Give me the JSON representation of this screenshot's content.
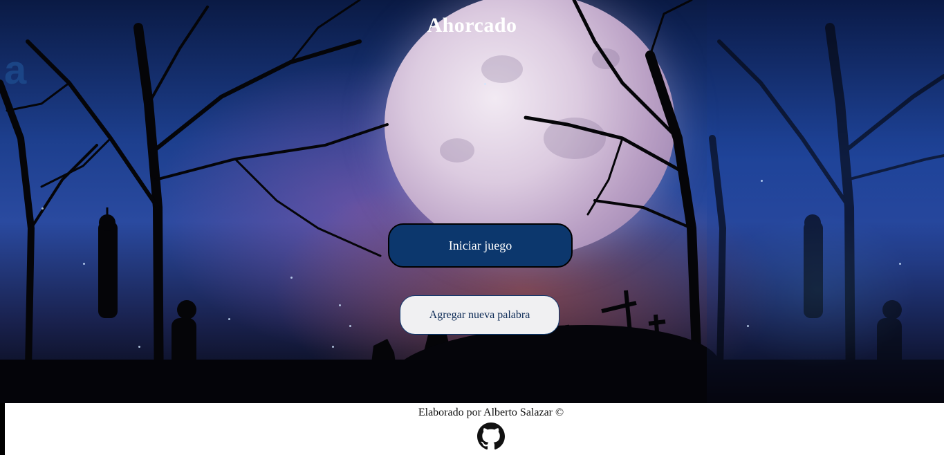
{
  "page": {
    "title": "Ahorcado",
    "watermark_letter": "a"
  },
  "actions": {
    "start_label": "Iniciar juego",
    "add_word_label": "Agregar nueva palabra"
  },
  "footer": {
    "credit": "Elaborado por Alberto Salazar ©",
    "github_icon": "github-icon"
  },
  "colors": {
    "start_button_bg": "#0c376d",
    "add_button_bg": "#f0f0f2",
    "title_text": "#ffffff"
  }
}
